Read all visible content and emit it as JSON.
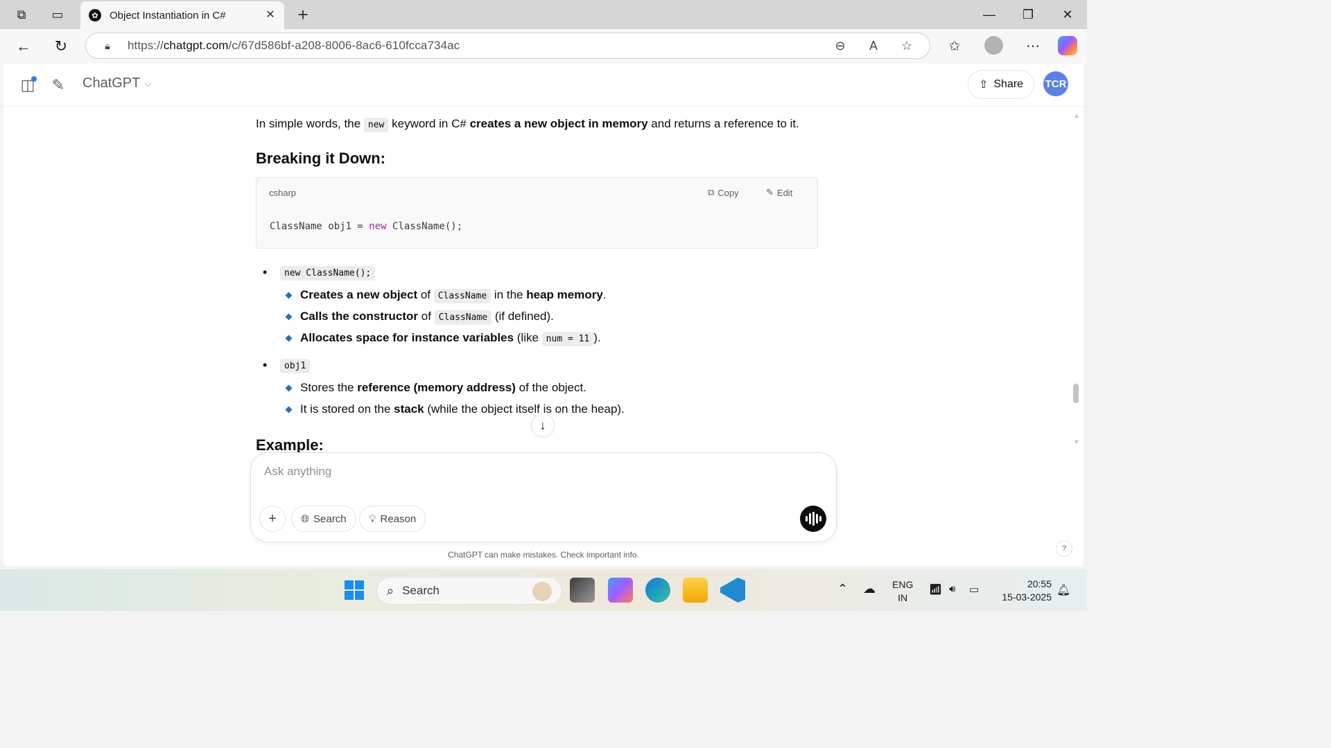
{
  "browser": {
    "tab_title": "Object Instantiation in C#",
    "url_prefix": "https://",
    "url_host": "chatgpt.com",
    "url_path": "/c/67d586bf-a208-8006-8ac6-610fcca734ac"
  },
  "header": {
    "brand": "ChatGPT",
    "share_label": "Share",
    "avatar_initials": "TCR"
  },
  "message": {
    "intro_pre": "In simple words, the ",
    "intro_code": "new",
    "intro_mid": " keyword in C# ",
    "intro_bold": "creates a new object in memory",
    "intro_post": " and returns a reference to it.",
    "heading": "Breaking it Down:",
    "code_block": {
      "language": "csharp",
      "copy_label": "Copy",
      "edit_label": "Edit",
      "code_pre": "ClassName obj1 = ",
      "code_kw": "new",
      "code_post": " ClassName();"
    },
    "bullets": [
      {
        "code": "new ClassName();",
        "items": [
          {
            "b1": "Creates a new object",
            "t1": " of ",
            "c1": "ClassName",
            "t2": " in the ",
            "b2": "heap memory",
            "t3": "."
          },
          {
            "b1": "Calls the constructor",
            "t1": " of ",
            "c1": "ClassName",
            "t2": " (if defined)."
          },
          {
            "b1": "Allocates space for instance variables",
            "t1": " (like ",
            "c1": "num = 11",
            "t2": ")."
          }
        ]
      },
      {
        "code": "obj1",
        "items": [
          {
            "t1": "Stores the ",
            "b1": "reference (memory address)",
            "t2": " of the object."
          },
          {
            "t1": "It is stored on the ",
            "b1": "stack",
            "t2": " (while the object itself is on the heap)."
          }
        ]
      }
    ],
    "next_heading": "Example:"
  },
  "composer": {
    "placeholder": "Ask anything",
    "search_label": "Search",
    "reason_label": "Reason"
  },
  "disclaimer": "ChatGPT can make mistakes. Check important info.",
  "help_label": "?",
  "taskbar": {
    "search_label": "Search",
    "lang_line1": "ENG",
    "lang_line2": "IN",
    "time": "20:55",
    "date": "15-03-2025"
  }
}
